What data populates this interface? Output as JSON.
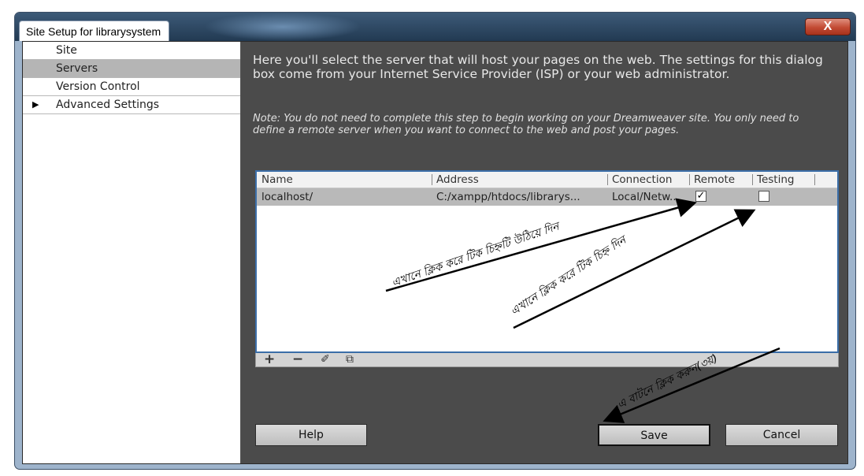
{
  "window": {
    "title": "Site Setup for librarysystem",
    "close_label": "X"
  },
  "sidebar": {
    "items": [
      {
        "label": "Site",
        "expander": ""
      },
      {
        "label": "Servers",
        "expander": ""
      },
      {
        "label": "Version Control",
        "expander": ""
      },
      {
        "label": "Advanced Settings",
        "expander": "▶"
      }
    ]
  },
  "main": {
    "intro": "Here you'll select the server that will host your pages on the web. The settings for this dialog box come from your Internet Service Provider (ISP) or your web administrator.",
    "note": "Note: You do not need to complete this step to begin working on your Dreamweaver site. You only need to define a remote server when you want to connect to the web and post your pages."
  },
  "servers_table": {
    "columns": [
      "Name",
      "Address",
      "Connection",
      "Remote",
      "Testing"
    ],
    "rows": [
      {
        "name": "localhost/",
        "address": "C:/xampp/htdocs/librarys...",
        "connection": "Local/Netw...",
        "remote": true,
        "testing": false
      }
    ]
  },
  "table_toolbar": {
    "add_icon": "+",
    "remove_icon": "−",
    "edit_icon": "✐",
    "duplicate_icon": "⧉"
  },
  "buttons": {
    "help": "Help",
    "save": "Save",
    "cancel": "Cancel"
  },
  "annotations": {
    "remote_hint": "এখানে ক্লিক করে টিক চিহ্নটি উঠিয়ে দিন",
    "testing_hint": "এখানে ক্লিক করে টিক চিহ্ন দিন",
    "save_hint": "এ বাটনে ক্লিক করুন(৩য়)"
  },
  "colors": {
    "titlebar": "#2b4662",
    "panel": "#4b4b4b",
    "selected_row": "#b9b9b9",
    "table_border": "#3b6ea8",
    "close_button": "#c24a33"
  }
}
